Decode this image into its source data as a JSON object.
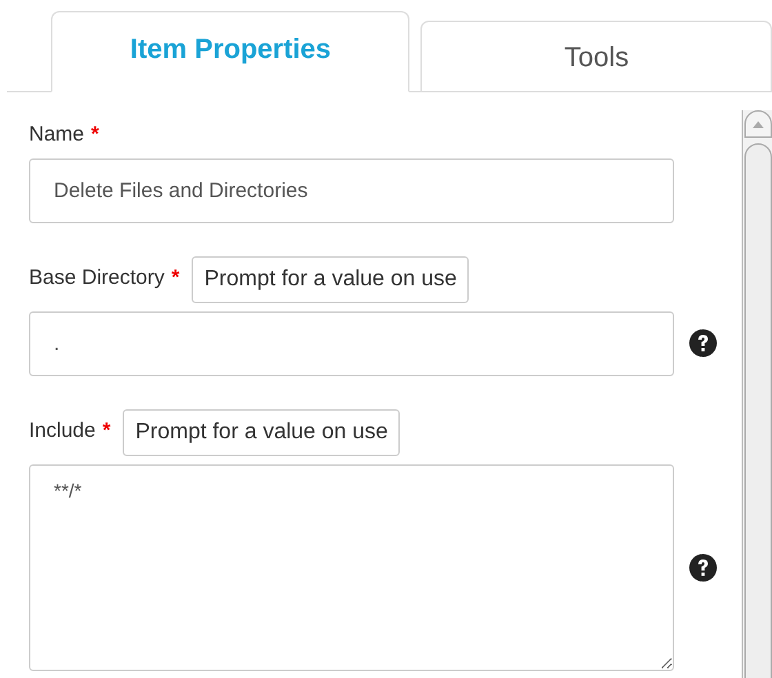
{
  "tabs": [
    {
      "label": "Item Properties",
      "selected": true
    },
    {
      "label": "Tools",
      "selected": false
    }
  ],
  "fields": [
    {
      "kind": "input",
      "label": "Name",
      "required_mark": "*",
      "value": "Delete Files and Directories",
      "help": false
    },
    {
      "kind": "input",
      "label": "Base Directory",
      "required_mark": "*",
      "prompt_button": "Prompt for a value on use",
      "value": ".",
      "help": true
    },
    {
      "kind": "textarea",
      "label": "Include",
      "required_mark": "*",
      "prompt_button": "Prompt for a value on use",
      "value": "**/*",
      "help": true
    }
  ]
}
